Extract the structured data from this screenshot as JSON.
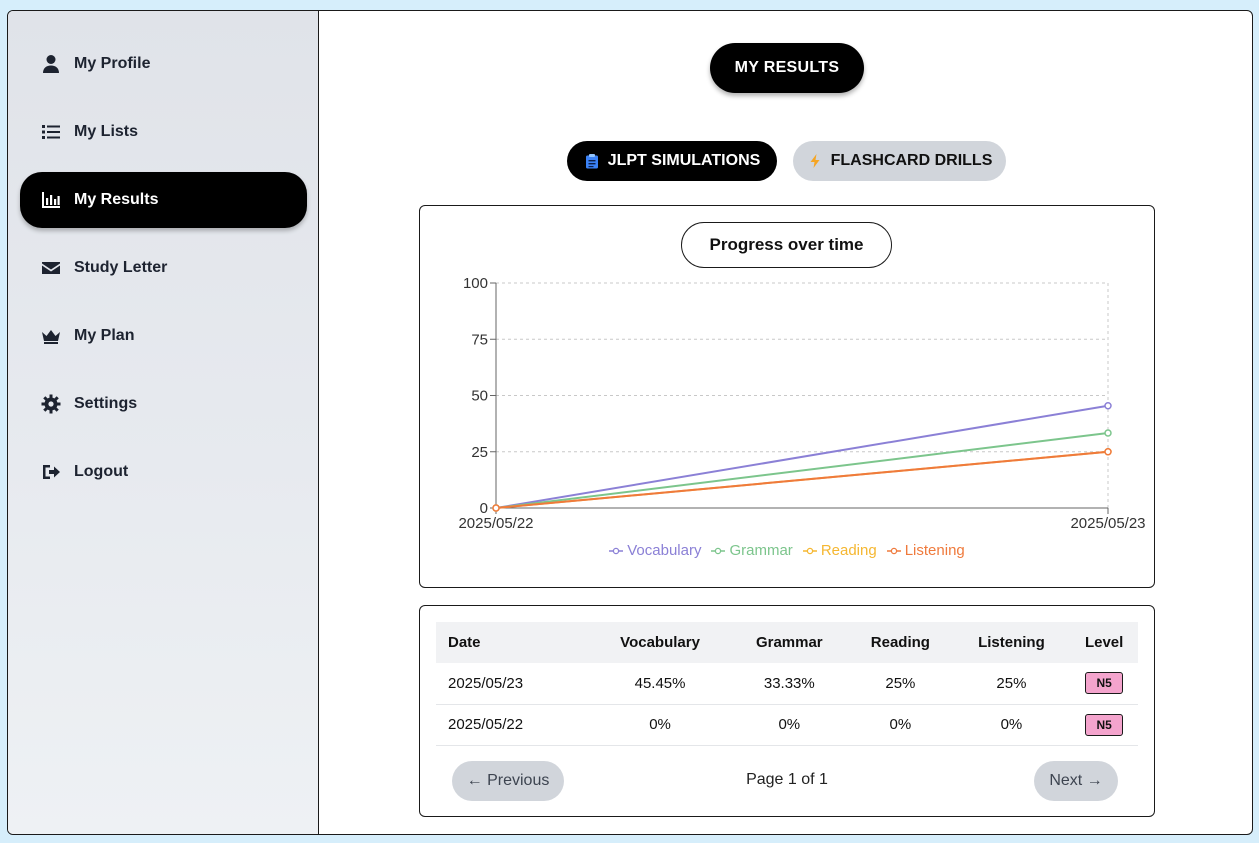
{
  "sidebar": {
    "items": [
      {
        "label": "My Profile",
        "icon": "user-icon"
      },
      {
        "label": "My Lists",
        "icon": "list-icon"
      },
      {
        "label": "My Results",
        "icon": "bar-chart-icon"
      },
      {
        "label": "Study Letter",
        "icon": "envelope-icon"
      },
      {
        "label": "My Plan",
        "icon": "crown-icon"
      },
      {
        "label": "Settings",
        "icon": "gear-icon"
      },
      {
        "label": "Logout",
        "icon": "logout-icon"
      }
    ],
    "active_index": 2
  },
  "main": {
    "title": "MY RESULTS",
    "tabs": [
      {
        "label": "JLPT SIMULATIONS",
        "icon": "clipboard-icon",
        "active": true
      },
      {
        "label": "FLASHCARD DRILLS",
        "icon": "bolt-icon",
        "active": false
      }
    ],
    "chart_title": "Progress over time"
  },
  "chart_data": {
    "type": "line",
    "title": "Progress over time",
    "x": [
      "2025/05/22",
      "2025/05/23"
    ],
    "series": [
      {
        "name": "Vocabulary",
        "values": [
          0,
          45.45
        ],
        "color": "#8b80d6"
      },
      {
        "name": "Grammar",
        "values": [
          0,
          33.33
        ],
        "color": "#7cc58c"
      },
      {
        "name": "Reading",
        "values": [
          0,
          25
        ],
        "color": "#f5b731"
      },
      {
        "name": "Listening",
        "values": [
          0,
          25
        ],
        "color": "#ef7a3c"
      }
    ],
    "ylim": [
      0,
      100
    ],
    "yticks": [
      0,
      25,
      50,
      75,
      100
    ],
    "grid": true,
    "legend": "bottom-center"
  },
  "table": {
    "headers": [
      "Date",
      "Vocabulary",
      "Grammar",
      "Reading",
      "Listening",
      "Level"
    ],
    "rows": [
      [
        "2025/05/23",
        "45.45%",
        "33.33%",
        "25%",
        "25%",
        "N5"
      ],
      [
        "2025/05/22",
        "0%",
        "0%",
        "0%",
        "0%",
        "N5"
      ]
    ]
  },
  "pagination": {
    "previous_label": "← Previous",
    "next_label": "Next →",
    "page_info": "Page 1 of 1"
  }
}
